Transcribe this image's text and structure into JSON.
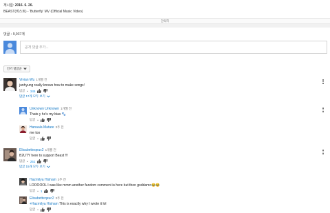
{
  "description": {
    "date_label": "게시일:",
    "date_value": "2016. 6. 26.",
    "line": "BEAST(비스트) - 'Butterfly' MV (Official Music Video)"
  },
  "show_less": "간략히",
  "comments_header": {
    "label": "댓글",
    "count": "9,937개"
  },
  "share": {
    "placeholder": "공개 댓글 추가..."
  },
  "sort_label": "인기 댓글순",
  "reply_label": "답글",
  "colors": {
    "link": "#167ac6",
    "like_count": "#128ee9",
    "default_avatar": "#4a89dc"
  },
  "comments": [
    {
      "author": "Vivian Wu",
      "time": "1개월 전",
      "text": "junhyung really knows how to make songs!",
      "likes": "345",
      "view_replies": "답글 17개 모두 보기",
      "replies": [
        {
          "author": "Unknown Unknown",
          "time": "1개월 전",
          "text": "Thats y he's my bias 🐾",
          "likes": ""
        },
        {
          "author": "Hanaala Matare",
          "time": "3주 전",
          "text": "me too",
          "likes": ""
        }
      ]
    },
    {
      "author": "Elisabetteqeuc2",
      "time": "1개월 전",
      "text": "B2UTY here to support Beast !!!",
      "likes": "251",
      "view_replies": "답글 15개 모두 보기",
      "replies": [
        {
          "author": "Hazmilya Hisham",
          "time": "3주 전",
          "text": "LOOOOOL I was like mmm another fandom comment is here but then goddamn😂😂",
          "likes": "1"
        },
        {
          "author": "Elisabetteqeuc2",
          "time": "3주 전",
          "mention": "+Hazmilya Hisham",
          "text": "This is exactly why I wrote it lol",
          "likes": ""
        }
      ]
    }
  ]
}
